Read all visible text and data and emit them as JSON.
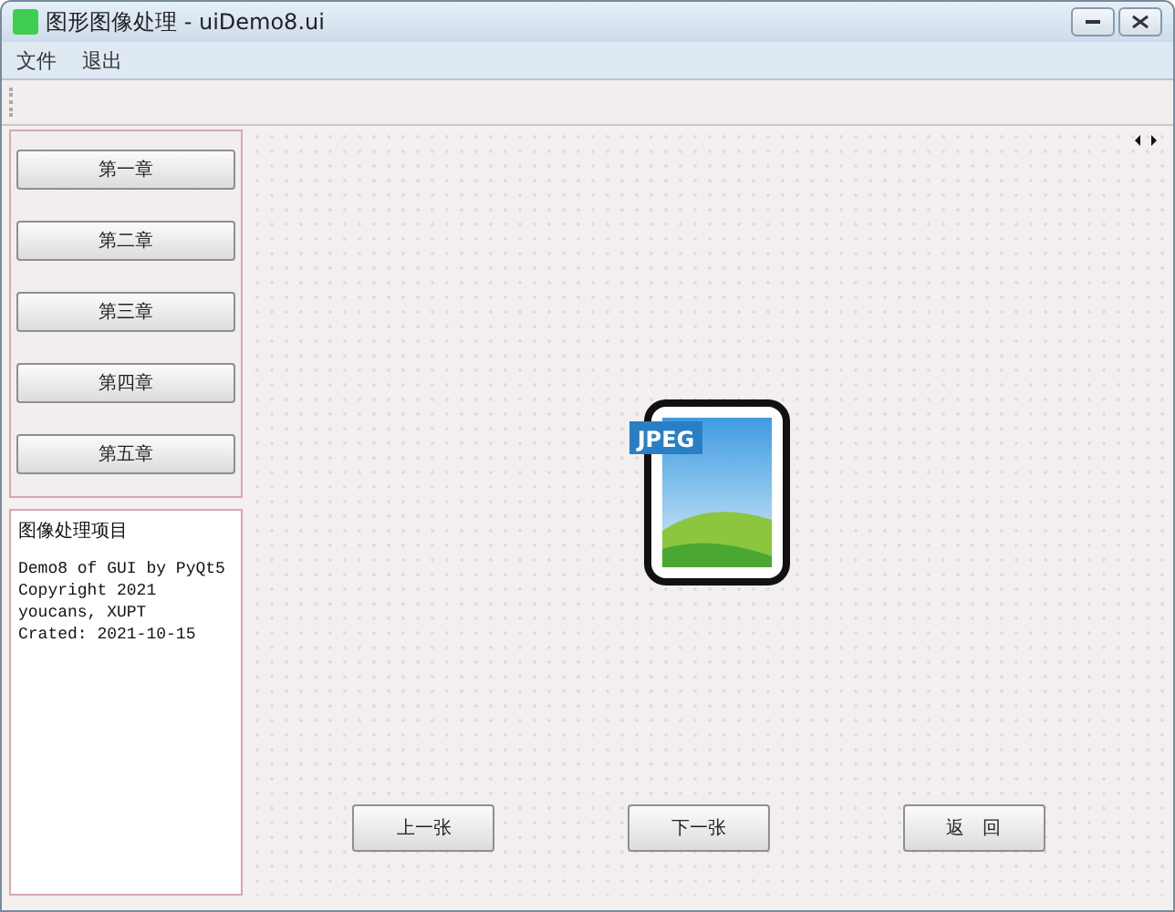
{
  "window": {
    "title": "图形图像处理 - uiDemo8.ui"
  },
  "menu": [
    "文件",
    "退出"
  ],
  "chapters": [
    "第一章",
    "第二章",
    "第三章",
    "第四章",
    "第五章"
  ],
  "info": {
    "title": "图像处理项目",
    "lines": [
      "Demo8 of GUI by PyQt5",
      "Copyright 2021 youcans, XUPT",
      "Crated: 2021-10-15"
    ]
  },
  "image": {
    "badge": "JPEG"
  },
  "nav_buttons": [
    "上一张",
    "下一张",
    "返　回"
  ]
}
